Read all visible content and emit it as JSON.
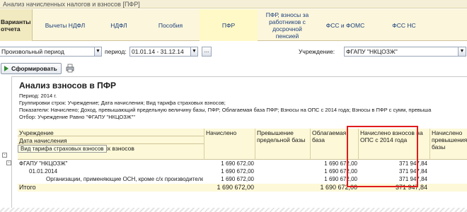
{
  "window": {
    "title": "Анализ начисленных налогов и взносов [ПФР]"
  },
  "tabs": [
    {
      "label": "Варианты отчета"
    },
    {
      "label": "Вычеты НДФЛ"
    },
    {
      "label": "НДФЛ"
    },
    {
      "label": "Пособия"
    },
    {
      "label": "ПФР"
    },
    {
      "label": "ПФР, взносы за работников с досрочной пенсией"
    },
    {
      "label": "ФСС и ФОМС"
    },
    {
      "label": "ФСС НС"
    }
  ],
  "filter": {
    "period_mode": "Произвольный период",
    "period_label": "период:",
    "period_value": "01.01.14 - 31.12.14",
    "period_button": "...",
    "org_label": "Учреждение:",
    "org_value": "ФГАПУ \"НКЦОЗЖ\""
  },
  "toolbar": {
    "generate_label": "Сформировать"
  },
  "report": {
    "title": "Анализ взносов в ПФР",
    "period_line": "Период: 2014 г.",
    "grouping_line": "Группировки строк: Учреждение; Дата начисления; Вид тарифа страховых взносов;",
    "indicators_line": "Показатели: Начислено; Доход, превышающий предельную величину базы, ПФР; Облагаемая база ПФР; Взносы на ОПС с 2014 года; Взносы в ПФР с сумм, превыша",
    "selection_line": "Отбор: Учреждение Равно \"ФГАПУ \"НКЦОЗЖ\"\"",
    "columns": {
      "group_1": "Учреждение",
      "group_2": "Дата начисления",
      "group_3": "Вид тарифа страховых взносов",
      "accrued": "Начислено",
      "excess_base": "Превышение предельной базы",
      "taxable_base": "Облагаемая база",
      "ops_2014": "Начислено взносов на ОПС с 2014 года",
      "accrued_excess": "Начислено превышения базы"
    },
    "tooltip": "Вид тарифа страховых взносов",
    "rows": [
      {
        "name": "ФГАПУ \"НКЦОЗЖ\"",
        "accrued": "1 690 672,00",
        "taxable_base": "1 690 672,00",
        "ops_2014": "371 947,84"
      },
      {
        "name": "01.01.2014",
        "accrued": "1 690 672,00",
        "taxable_base": "1 690 672,00",
        "ops_2014": "371 947,84"
      },
      {
        "name": "Организации, применяющие ОСН, кроме с/х производителей",
        "accrued": "1 690 672,00",
        "taxable_base": "1 690 672,00",
        "ops_2014": "371 947,84"
      }
    ],
    "total": {
      "name": "Итого",
      "accrued": "1 690 672,00",
      "taxable_base": "1 690 672,00",
      "ops_2014": "371 947,84"
    }
  },
  "colors": {
    "highlight": "#e11c1c",
    "header_bg": "#fdf8d7",
    "tab_bg": "#fbf6dc"
  }
}
